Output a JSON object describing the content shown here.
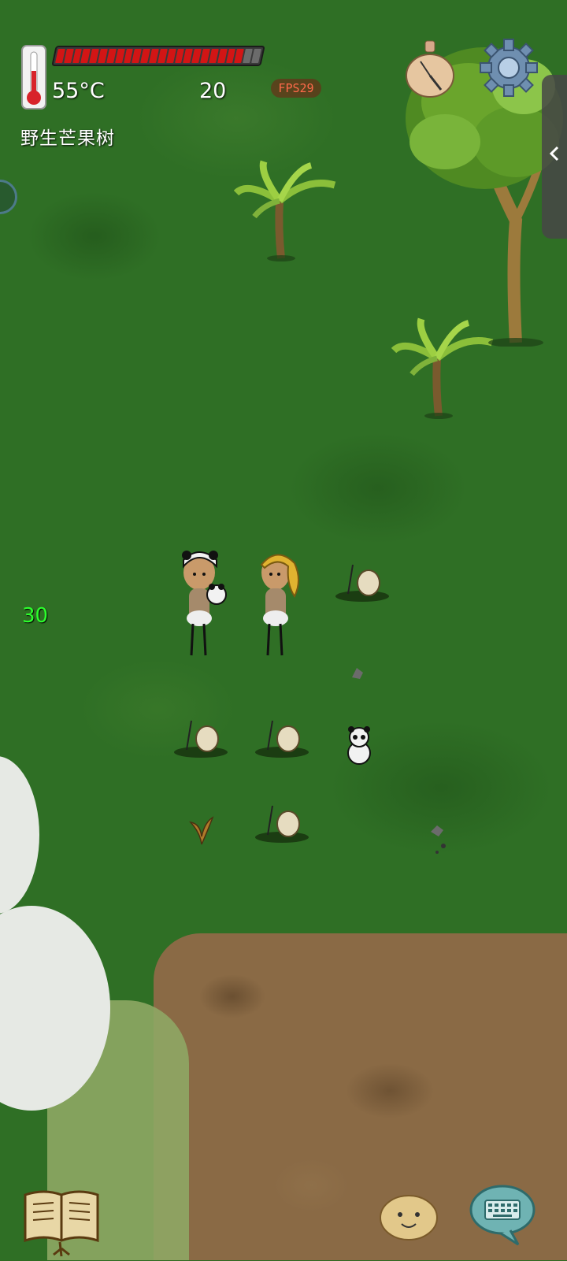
{
  "hud": {
    "temperature": "55°C",
    "count": "20",
    "fps": "FPS29",
    "biome": "野生芒果树",
    "side_value": "30",
    "health_fraction": 0.92,
    "health_segments_filled": 22,
    "health_segments_total": 24
  },
  "icons": {
    "thermometer": "thermometer-icon",
    "compass": "compass-icon",
    "settings": "gear-icon",
    "drawer": "chevron-left-icon",
    "recipe_book": "book-icon",
    "emote": "smiley-potato-icon",
    "chat": "keyboard-icon"
  },
  "colors": {
    "health": "#d21515",
    "grass": "#2f6f25",
    "mud": "#8a6a45",
    "side_value": "#2cff2c",
    "fps": "#ff6a4a"
  }
}
